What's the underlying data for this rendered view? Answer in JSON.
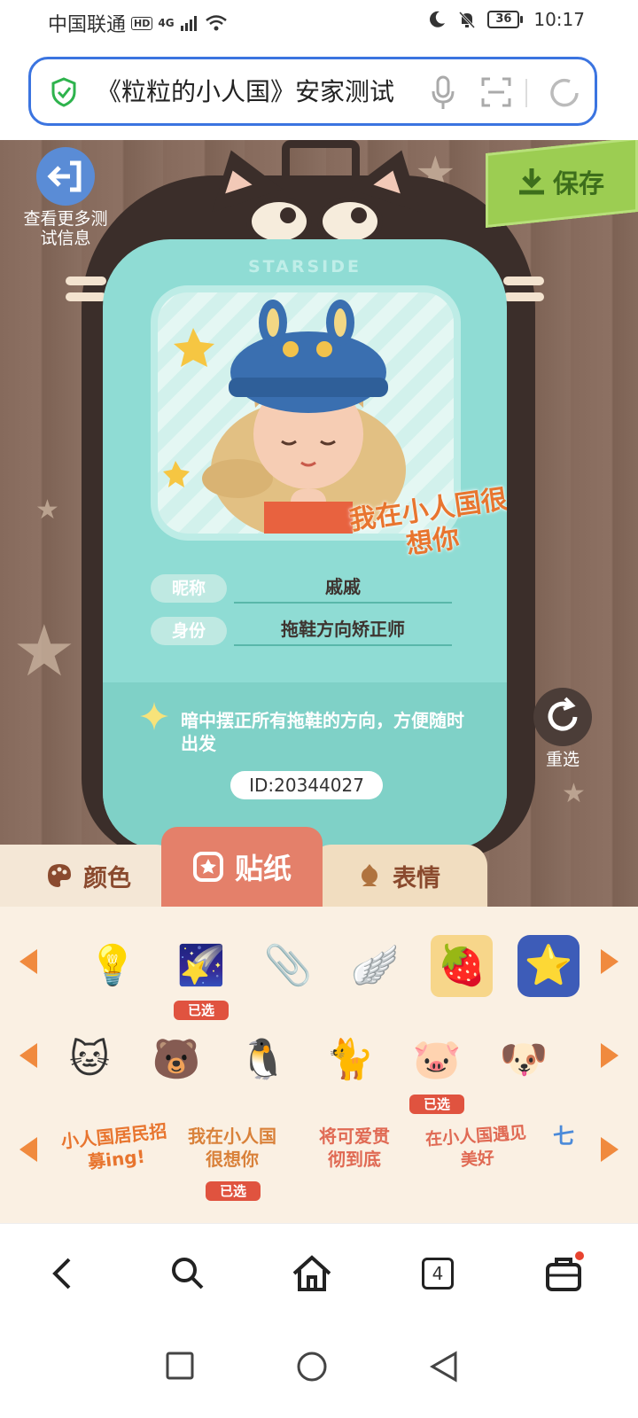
{
  "status_bar": {
    "carrier": "中国联通",
    "hd": "HD",
    "network": "4G",
    "battery": "36",
    "time": "10:17"
  },
  "address_bar": {
    "title": "《粒粒的小人国》安家测试"
  },
  "game": {
    "more_info_label": "查看更多测试信息",
    "save_label": "保存",
    "brand": "STARSIDE",
    "stamp_text": "我在小人国很想你",
    "nickname_label": "昵称",
    "nickname_value": "戚戚",
    "identity_label": "身份",
    "identity_value": "拖鞋方向矫正师",
    "description": "暗中摆正所有拖鞋的方向，方便随时出发",
    "id_text": "ID:20344027",
    "reselect_label": "重选"
  },
  "tabs": [
    {
      "label": "颜色",
      "icon": "palette-icon",
      "active": false
    },
    {
      "label": "贴纸",
      "icon": "sticker-icon",
      "active": true
    },
    {
      "label": "表情",
      "icon": "face-icon",
      "active": false
    }
  ],
  "sticker_rows": [
    {
      "items": [
        {
          "name": "lightbulb",
          "glyph": "💡",
          "selected": false
        },
        {
          "name": "shooting-star",
          "glyph": "🌠",
          "selected": true
        },
        {
          "name": "paperclip",
          "glyph": "📎",
          "selected": false
        },
        {
          "name": "blue-wing",
          "glyph": "🪽",
          "selected": false
        },
        {
          "name": "fruit-frame",
          "glyph": "🍓",
          "selected": false
        },
        {
          "name": "star-frame",
          "glyph": "⭐",
          "selected": false
        }
      ]
    },
    {
      "items": [
        {
          "name": "green-cat",
          "glyph": "🐱",
          "selected": false
        },
        {
          "name": "brown-cat-hat",
          "glyph": "🐻",
          "selected": false
        },
        {
          "name": "penguin-headphones",
          "glyph": "🐧",
          "selected": false
        },
        {
          "name": "black-cat",
          "glyph": "🐈",
          "selected": false
        },
        {
          "name": "pink-pig",
          "glyph": "🐷",
          "selected": true
        },
        {
          "name": "dog",
          "glyph": "🐶",
          "selected": false
        }
      ]
    },
    {
      "items": [
        {
          "name": "text-recruit",
          "text": "小人国居民招募ing!",
          "selected": false
        },
        {
          "name": "text-miss-you",
          "text": "我在小人国很想你",
          "selected": true
        },
        {
          "name": "text-cute",
          "text": "将可爱贯彻到底",
          "selected": false
        },
        {
          "name": "text-meet",
          "text": "在小人国遇见美好",
          "selected": false
        },
        {
          "name": "text-partial",
          "text": "七",
          "selected": false
        }
      ]
    }
  ],
  "selected_badge": "已选",
  "bottom_nav": {
    "tab_count": "4"
  },
  "colors": {
    "accent_blue": "#3b74e0",
    "card_teal": "#8fdcd4",
    "tab_active": "#e4806a",
    "arrow_orange": "#f08a3e",
    "badge_red": "#e0533f",
    "save_green": "#9ccd52"
  }
}
